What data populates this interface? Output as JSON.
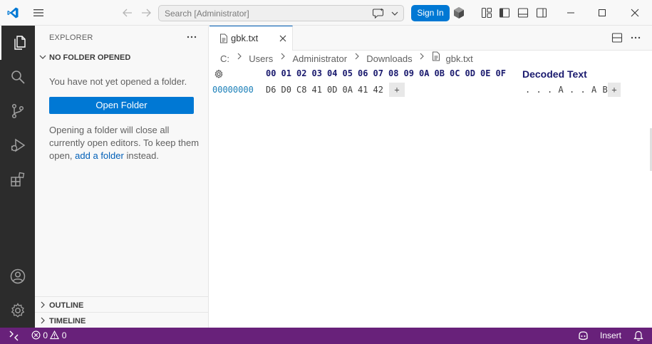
{
  "titlebar": {
    "search_placeholder": "Search [Administrator]",
    "signin_label": "Sign In"
  },
  "sidebar": {
    "title": "EXPLORER",
    "section_header": "NO FOLDER OPENED",
    "message": "You have not yet opened a folder.",
    "open_folder_label": "Open Folder",
    "info_prefix": "Opening a folder will close all currently open editors. To keep them open,",
    "info_link": "add a folder",
    "info_suffix": "instead.",
    "outline_label": "OUTLINE",
    "timeline_label": "TIMELINE"
  },
  "editor": {
    "tab_label": "gbk.txt",
    "breadcrumb": [
      "C:",
      "Users",
      "Administrator",
      "Downloads",
      "gbk.txt"
    ],
    "hex": {
      "header_columns": [
        "00",
        "01",
        "02",
        "03",
        "04",
        "05",
        "06",
        "07",
        "08",
        "09",
        "0A",
        "0B",
        "0C",
        "0D",
        "0E",
        "0F"
      ],
      "decoded_title": "Decoded Text",
      "rows": [
        {
          "offset": "00000000",
          "bytes": [
            "D6",
            "D0",
            "C8",
            "41",
            "0D",
            "0A",
            "41",
            "42"
          ],
          "decoded": [
            ".",
            ".",
            ".",
            "A",
            ".",
            ".",
            "A",
            "B"
          ]
        }
      ],
      "add_label": "+"
    }
  },
  "statusbar": {
    "errors": "0",
    "warnings": "0",
    "mode": "Insert"
  },
  "colors": {
    "accent": "#0078d4",
    "statusbar": "#68217a",
    "activitybar": "#2c2c2c"
  }
}
